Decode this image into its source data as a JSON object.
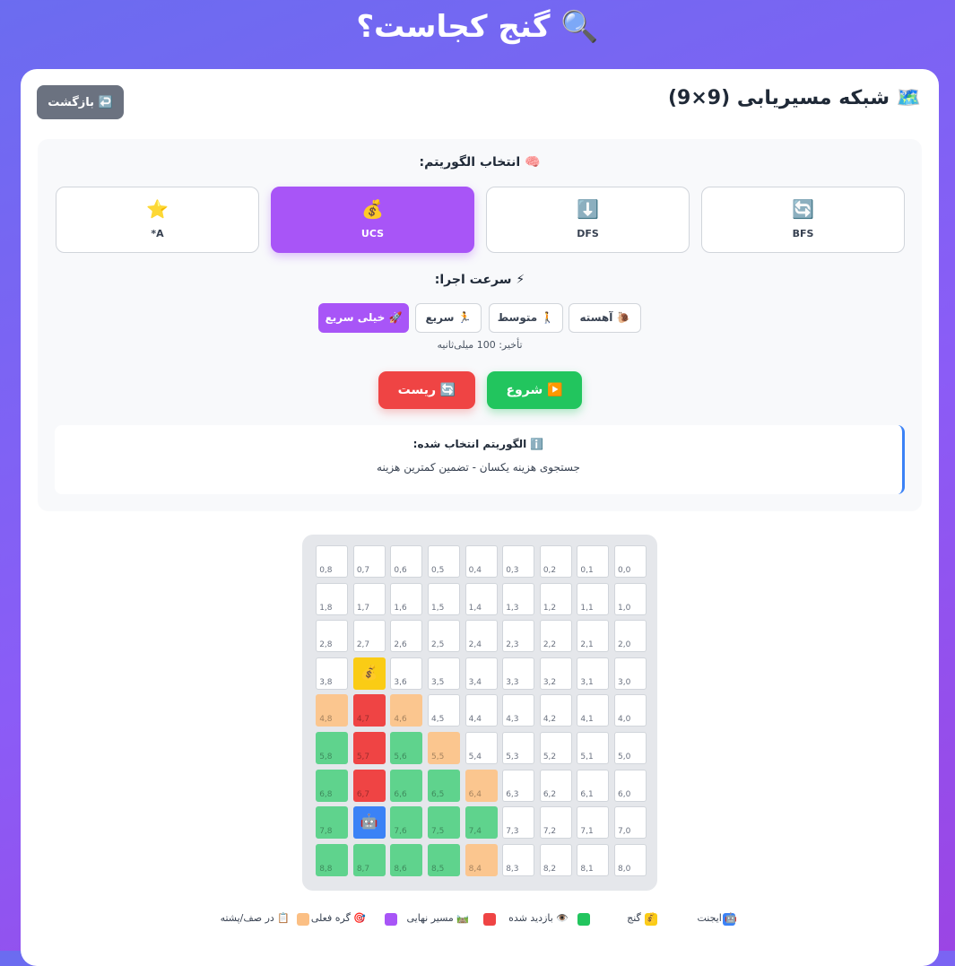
{
  "header": {
    "title": "🔍 گنج کجاست؟"
  },
  "panel": {
    "grid_title": "🗺️ شبکه مسیریابی (9×9)",
    "back_label": "↩️ بازگشت"
  },
  "algorithms": {
    "title": "🧠 انتخاب الگوریتم:",
    "selected": "UCS",
    "items": [
      {
        "icon": "🔄",
        "label": "BFS",
        "icon_name": "refresh-icon"
      },
      {
        "icon": "⬇️",
        "label": "DFS",
        "icon_name": "arrow-down-icon"
      },
      {
        "icon": "💰",
        "label": "UCS",
        "icon_name": "money-bag-icon"
      },
      {
        "icon": "⭐",
        "label": "A*",
        "icon_name": "star-icon"
      }
    ]
  },
  "speed": {
    "title": "⚡ سرعت اجرا:",
    "selected": "🚀 خیلی سریع",
    "options": [
      "🐌 آهسته",
      "🚶 متوسط",
      "🏃 سریع",
      "🚀 خیلی سریع"
    ],
    "delay_text": "تأخیر: 100 میلی‌ثانیه"
  },
  "actions": {
    "start_label": "▶️ شروع",
    "reset_label": "🔄 ریست"
  },
  "info": {
    "title": "ℹ️ الگوریتم انتخاب شده:",
    "description": "جستجوی هزینه یکسان - تضمین کمترین هزینه"
  },
  "grid": {
    "size": 9,
    "cell_colors": {
      "empty": "#ffffff",
      "agent": "#3b82f6",
      "treasure": "#facc15",
      "visited": "#5fd38d",
      "path": "#ef4444",
      "queue": "#fbc68f"
    },
    "agent_glyph": "🤖",
    "treasure_glyph": "💰",
    "agent": [
      7,
      7
    ],
    "treasure": [
      3,
      7
    ],
    "path": [
      [
        4,
        7
      ],
      [
        5,
        7
      ],
      [
        6,
        7
      ]
    ],
    "visited": [
      [
        5,
        8
      ],
      [
        5,
        6
      ],
      [
        6,
        8
      ],
      [
        6,
        6
      ],
      [
        6,
        5
      ],
      [
        7,
        8
      ],
      [
        7,
        6
      ],
      [
        7,
        5
      ],
      [
        7,
        4
      ],
      [
        8,
        8
      ],
      [
        8,
        7
      ],
      [
        8,
        6
      ],
      [
        8,
        5
      ]
    ],
    "queue": [
      [
        4,
        8
      ],
      [
        4,
        6
      ],
      [
        5,
        5
      ],
      [
        6,
        4
      ],
      [
        8,
        4
      ]
    ]
  },
  "legend": [
    {
      "label": "🤖 ایجنت",
      "color": "#3b82f6"
    },
    {
      "label": "💰 گنج",
      "color": "#facc15"
    },
    {
      "label": "👁️ بازدید شده",
      "color": "#22c55e"
    },
    {
      "label": "🛤️ مسیر نهایی",
      "color": "#ef4444"
    },
    {
      "label": "🎯 گره فعلی",
      "color": "#a855f7"
    },
    {
      "label": "📋 در صف/پشته",
      "color": "#fbbf84"
    }
  ]
}
